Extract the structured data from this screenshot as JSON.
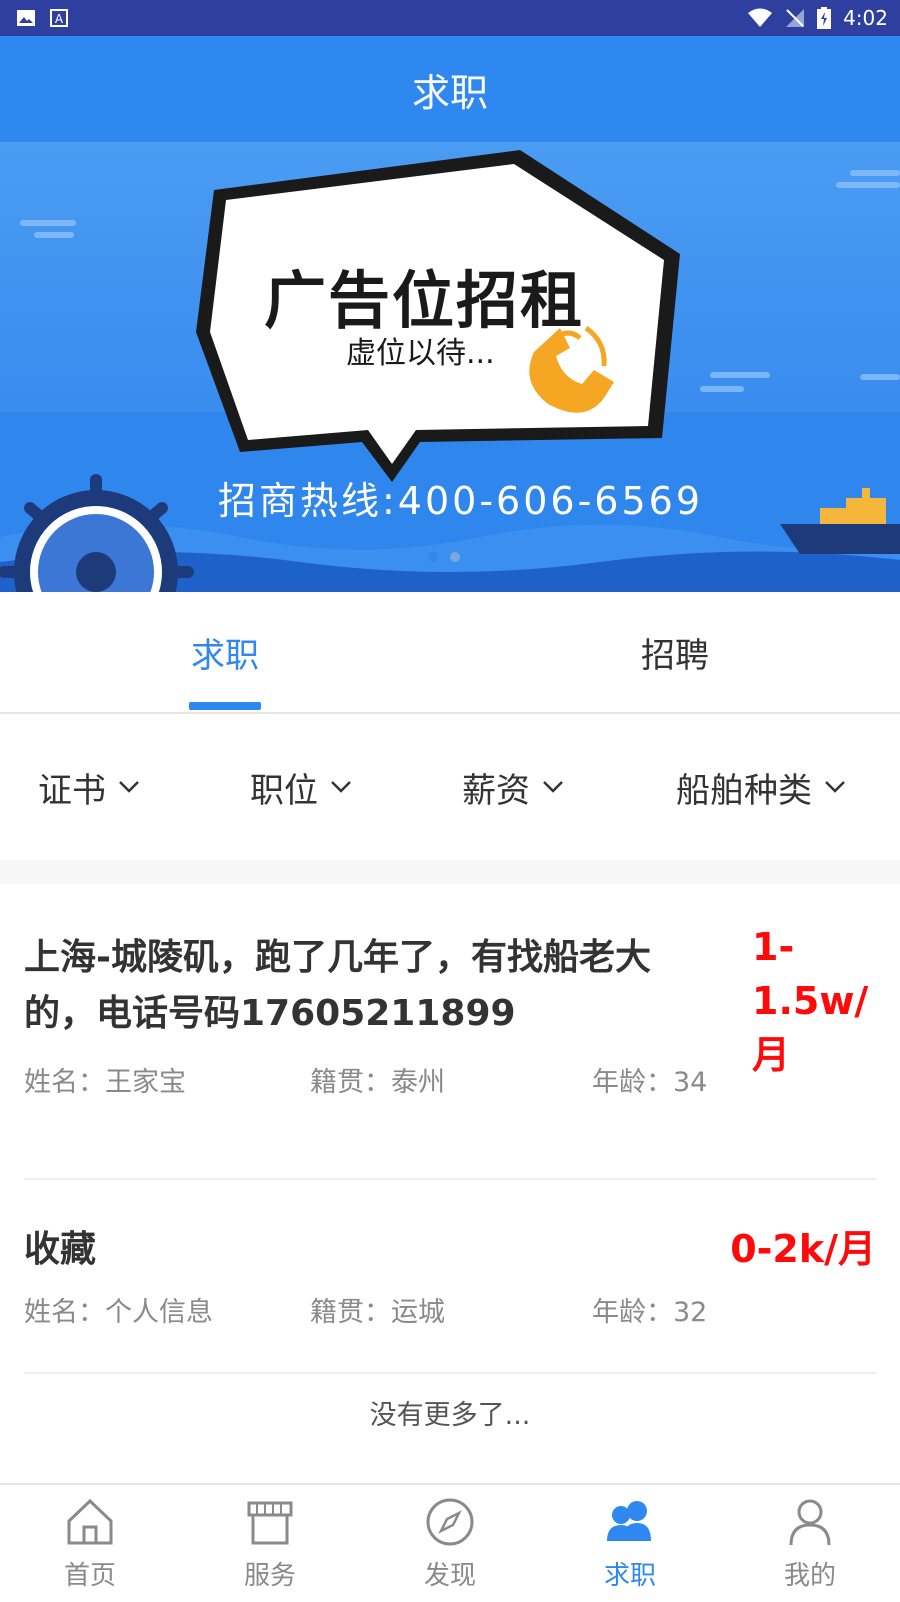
{
  "status_bar": {
    "time": "4:02"
  },
  "app_bar": {
    "title": "求职"
  },
  "banner": {
    "headline": "广告位招租",
    "subline": "虚位以待...",
    "hotline": "招商热线:400-606-6569"
  },
  "tabs": [
    {
      "label": "求职",
      "active": true
    },
    {
      "label": "招聘",
      "active": false
    }
  ],
  "filters": [
    {
      "label": "证书"
    },
    {
      "label": "职位"
    },
    {
      "label": "薪资"
    },
    {
      "label": "船舶种类"
    }
  ],
  "jobs": [
    {
      "title": "上海-城陵矶，跑了几年了，有找船老大的，电话号码17605211899",
      "salary": "1-1.5w/月",
      "name": "姓名：王家宝",
      "origin": "籍贯：泰州",
      "age": "年龄：34"
    },
    {
      "title": "收藏",
      "salary": "0-2k/月",
      "name": "姓名：个人信息",
      "origin": "籍贯：运城",
      "age": "年龄：32"
    }
  ],
  "no_more": "没有更多了...",
  "bottom_nav": [
    {
      "label": "首页",
      "icon": "home-icon"
    },
    {
      "label": "服务",
      "icon": "store-icon"
    },
    {
      "label": "发现",
      "icon": "compass-icon"
    },
    {
      "label": "求职",
      "icon": "users-icon",
      "active": true
    },
    {
      "label": "我的",
      "icon": "person-icon"
    }
  ],
  "colors": {
    "primary": "#2f88f0",
    "salary": "#ff0a0a",
    "statusbar": "#2f3f9f"
  }
}
